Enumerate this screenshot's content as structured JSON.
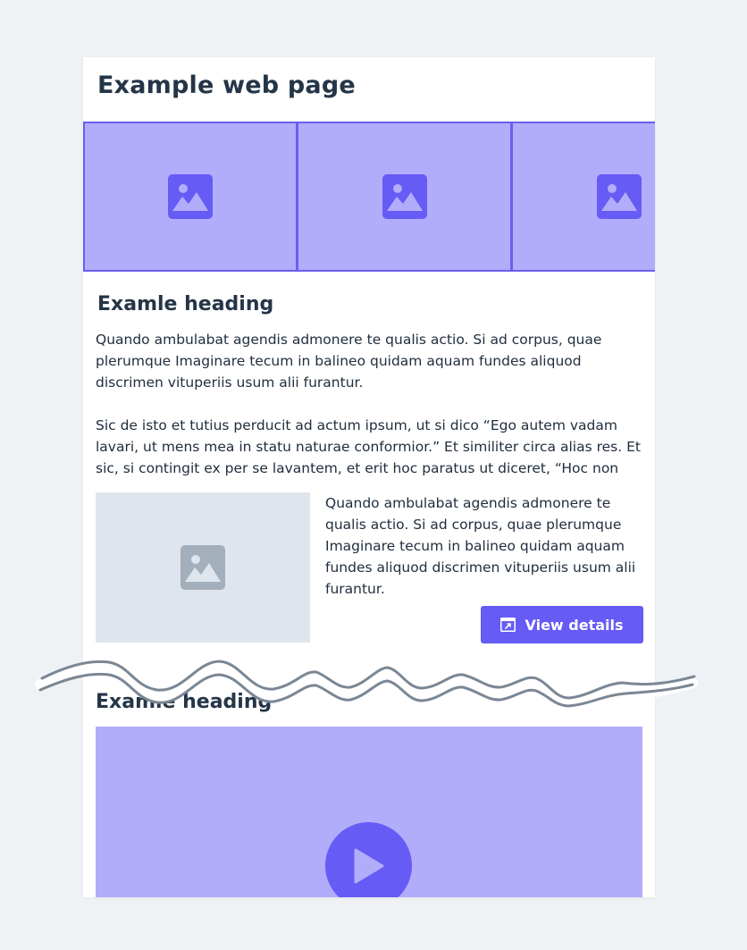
{
  "page": {
    "title": "Example web page"
  },
  "carousel": {
    "slides": [
      {
        "icon": "image-icon"
      },
      {
        "icon": "image-icon"
      },
      {
        "icon": "image-icon"
      }
    ]
  },
  "section1": {
    "heading": "Examle heading",
    "paragraph1": "Quando ambulabat agendis admonere te qualis actio. Si ad corpus, quae plerumque Imaginare tecum in balineo quidam aquam fundes aliquod discrimen vituperiis usum alii furantur.",
    "paragraph2": "Sic de isto et tutius perducit ad actum ipsum, ut si dico “Ego autem vadam lavari, ut mens mea in statu naturae conformior.” Et similiter circa alias res. Et sic, si contingit ex per se lavantem, et erit hoc paratus ut diceret, “Hoc non"
  },
  "media_object": {
    "image_icon": "image-icon",
    "text": "Quando ambulabat agendis admonere te qualis actio. Si ad corpus, quae plerumque Imaginare tecum in balineo quidam aquam fundes aliquod discrimen vituperiis usum alii furantur.",
    "button_label": "View details",
    "button_icon": "external-window-icon"
  },
  "section2": {
    "heading": "Examle heading",
    "video_icon": "play-icon"
  },
  "colors": {
    "background": "#eff2f5",
    "surface": "#ffffff",
    "accent": "#665bf4",
    "accent_light": "#b2adfb",
    "placeholder_gray": "#dfe5ed",
    "text_dark": "#243547",
    "tear_line": "#7a8794"
  }
}
